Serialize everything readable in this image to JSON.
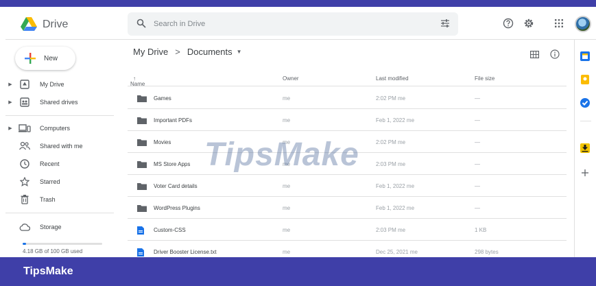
{
  "header": {
    "app_name": "Drive",
    "search_placeholder": "Search in Drive",
    "icons": [
      "drive-logo-icon",
      "search-icon",
      "filter-options-icon",
      "help-icon",
      "settings-icon",
      "apps-grid-icon",
      "avatar"
    ]
  },
  "sidebar": {
    "new_label": "New",
    "items": [
      {
        "label": "My Drive",
        "icon": "my-drive-icon"
      },
      {
        "label": "Shared drives",
        "icon": "shared-drives-icon"
      },
      {
        "label": "Computers",
        "icon": "computers-icon"
      },
      {
        "label": "Shared with me",
        "icon": "shared-with-me-icon"
      },
      {
        "label": "Recent",
        "icon": "recent-icon"
      },
      {
        "label": "Starred",
        "icon": "star-icon"
      },
      {
        "label": "Trash",
        "icon": "trash-icon"
      },
      {
        "label": "Storage",
        "icon": "cloud-icon"
      }
    ],
    "storage_text": "4.18 GB of 100 GB used",
    "storage_used_fraction": 0.042
  },
  "main": {
    "breadcrumb": {
      "root": "My Drive",
      "separator": ">",
      "current": "Documents"
    },
    "columns": {
      "name": "Name",
      "owner": "Owner",
      "modified": "Last modified",
      "size": "File size"
    },
    "files": [
      {
        "name": "Games",
        "type": "folder",
        "owner": "me",
        "modified": "2:02 PM me",
        "size": "—"
      },
      {
        "name": "Important PDFs",
        "type": "folder",
        "owner": "me",
        "modified": "Feb 1, 2022 me",
        "size": "—"
      },
      {
        "name": "Movies",
        "type": "folder",
        "owner": "me",
        "modified": "2:02 PM me",
        "size": "—"
      },
      {
        "name": "MS Store Apps",
        "type": "folder",
        "owner": "me",
        "modified": "2:03 PM me",
        "size": "—"
      },
      {
        "name": "Voter Card details",
        "type": "folder",
        "owner": "me",
        "modified": "Feb 1, 2022 me",
        "size": "—"
      },
      {
        "name": "WordPress Plugins",
        "type": "folder",
        "owner": "me",
        "modified": "Feb 1, 2022 me",
        "size": "—"
      },
      {
        "name": "Custom-CSS",
        "type": "doc",
        "owner": "me",
        "modified": "2:03 PM me",
        "size": "1 KB"
      },
      {
        "name": "Driver Booster License.txt",
        "type": "doc",
        "owner": "me",
        "modified": "Dec 25, 2021 me",
        "size": "298 bytes"
      }
    ]
  },
  "colors": {
    "accent": "#1a73e8",
    "frame": "#3f3fa8",
    "folder": "#5f6368"
  },
  "watermark": "TipsMake",
  "footer": {
    "brand": "TipsMake"
  }
}
